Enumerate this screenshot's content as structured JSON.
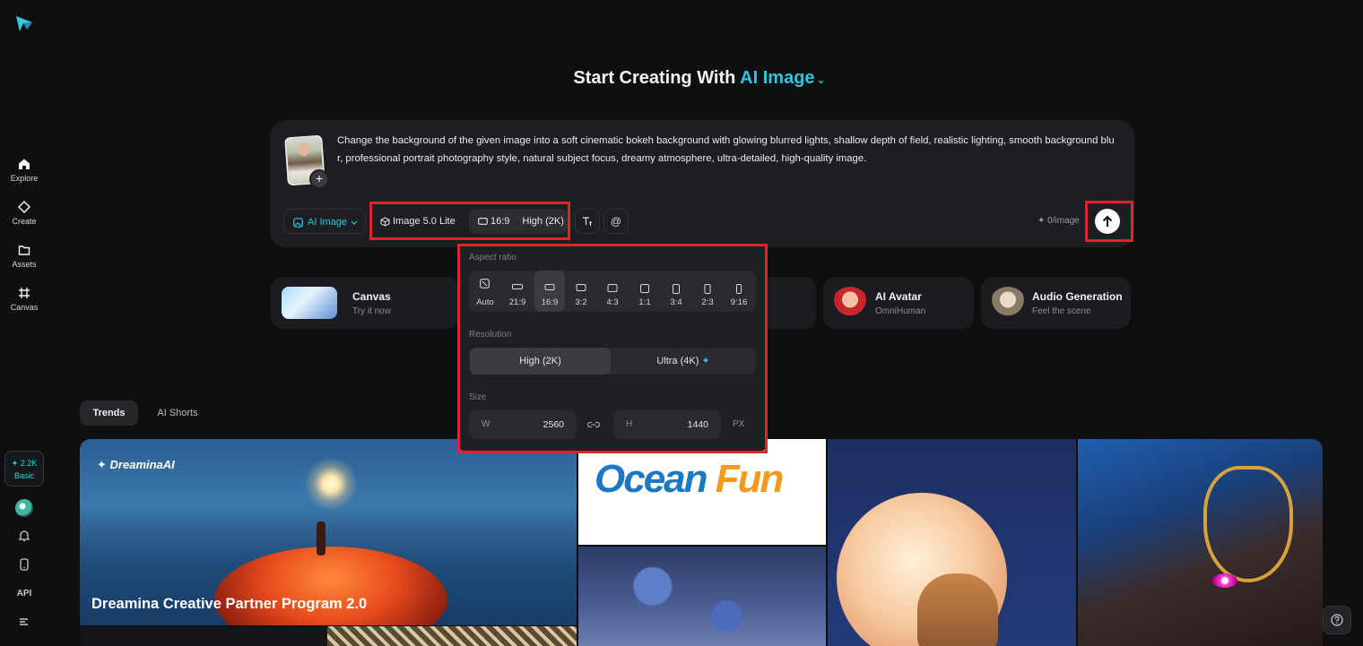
{
  "nav": {
    "items": [
      {
        "label": "Explore",
        "icon": "home-icon"
      },
      {
        "label": "Create",
        "icon": "diamond-icon"
      },
      {
        "label": "Assets",
        "icon": "folder-icon"
      },
      {
        "label": "Canvas",
        "icon": "frame-icon"
      }
    ],
    "credits": {
      "amount": "✦ 2.2K",
      "plan": "Basic"
    },
    "api_label": "API"
  },
  "heading": {
    "prefix": "Start Creating With",
    "mode": "AI Image",
    "chevron": "⌄"
  },
  "prompt": {
    "text": "Change the background of the given image into a soft cinematic bokeh background with glowing blurred lights, shallow depth of field, realistic lighting, smooth background blur, professional portrait photography style, natural subject focus, dreamy atmosphere, ultra-detailed, high-quality image.",
    "add_symbol": "+"
  },
  "toolbar": {
    "mode_label": "AI Image",
    "model_label": "Image 5.0 Lite",
    "ratio_label": "16:9",
    "resolution_label": "High (2K)",
    "text_tool": "T",
    "mention_tool": "@",
    "counter": "✦ 0/image"
  },
  "features": [
    {
      "title": "Canvas",
      "subtitle": "Try it now"
    },
    {
      "title": "AI Avatar",
      "subtitle": "OmniHuman"
    },
    {
      "title": "Audio Generation",
      "subtitle": "Feel the scene"
    }
  ],
  "dropdown": {
    "aspect_label": "Aspect ratio",
    "ratios": [
      "Auto",
      "21:9",
      "16:9",
      "3:2",
      "4:3",
      "1:1",
      "3:4",
      "2:3",
      "9:16"
    ],
    "selected_ratio": "16:9",
    "resolution_label": "Resolution",
    "resolutions": [
      "High (2K)",
      "Ultra (4K)"
    ],
    "selected_resolution": "High (2K)",
    "size_label": "Size",
    "width_key": "W",
    "width_value": "2560",
    "height_key": "H",
    "height_value": "1440",
    "unit": "PX"
  },
  "tabs": [
    {
      "label": "Trends",
      "active": true
    },
    {
      "label": "AI Shorts",
      "active": false
    }
  ],
  "gallery": {
    "brand": "DreaminaAI",
    "featured_title": "Dreamina Creative Partner Program 2.0",
    "ocean_prefix": "Ocean",
    "ocean_suffix": " Fun"
  },
  "colors": {
    "accent": "#29c8e0",
    "highlight": "#e0242c",
    "background": "#0f0f10"
  }
}
